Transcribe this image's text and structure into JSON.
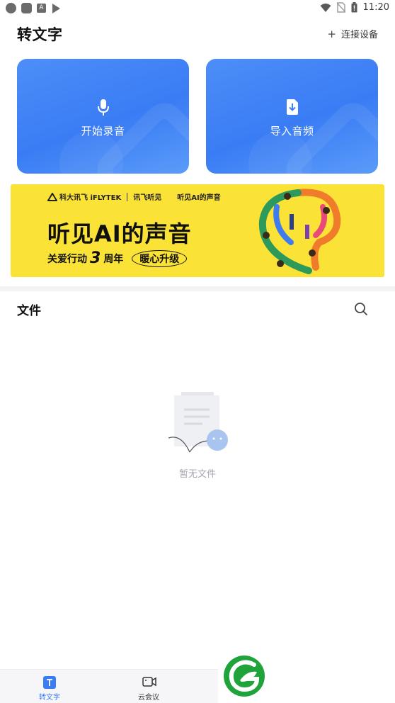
{
  "status_bar": {
    "time": "11:20"
  },
  "header": {
    "title": "转文字",
    "connect_label": "连接设备",
    "connect_plus": "+"
  },
  "actions": [
    {
      "label": "开始录音",
      "icon": "microphone-icon"
    },
    {
      "label": "导入音频",
      "icon": "import-audio-icon"
    }
  ],
  "banner": {
    "brand_logo": "科大讯飞 iFLYTEK",
    "partner_logo": "讯飞听见",
    "event_logo": "听见AI的声音",
    "headline": "听见AI的声音",
    "subtitle_prefix": "关爱行动",
    "subtitle_number": "3",
    "subtitle_suffix": "周年",
    "subtitle_tag": "暖心升级"
  },
  "files": {
    "title": "文件",
    "empty_text": "暂无文件"
  },
  "bottom_nav": [
    {
      "label": "转文字",
      "icon": "transcribe-icon",
      "active": true
    },
    {
      "label": "云会议",
      "icon": "video-meeting-icon",
      "active": false
    }
  ],
  "colors": {
    "accent": "#3b7cf5",
    "card": "#4389f6",
    "banner": "#fbe236",
    "watermark": "#1fa33a"
  }
}
